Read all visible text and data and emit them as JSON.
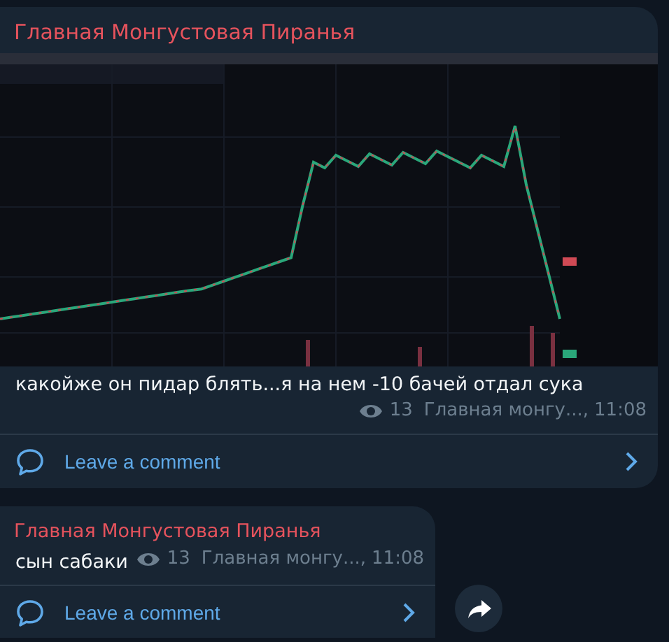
{
  "messages": [
    {
      "author": "Главная Монгустовая Пиранья",
      "text": "какойже он пидар блять...я на нем -10 бачей отдал сука",
      "views": "13",
      "signature": "Главная монгу...,",
      "time": "11:08",
      "comment_label": "Leave a comment",
      "inline_meta": false,
      "share_button": false
    },
    {
      "author": "Главная Монгустовая Пиранья",
      "text": "сын сабаки",
      "views": "13",
      "signature": "Главная монгу...,",
      "time": "11:08",
      "comment_label": "Leave a comment",
      "inline_meta": true,
      "share_button": true
    }
  ]
}
